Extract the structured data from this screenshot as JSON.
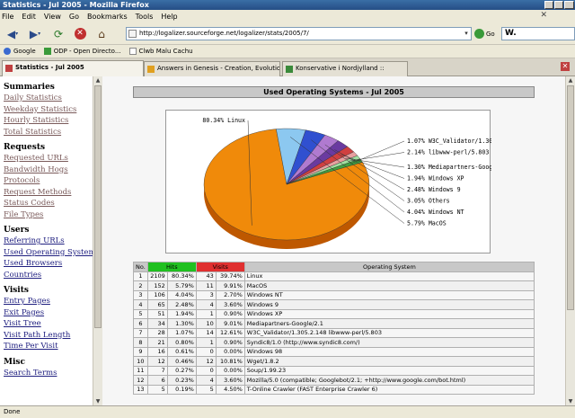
{
  "window": {
    "title": "Statistics - Jul 2005 - Mozilla Firefox"
  },
  "menu": [
    "File",
    "Edit",
    "View",
    "Go",
    "Bookmarks",
    "Tools",
    "Help"
  ],
  "nav": {
    "url": "http://logalizer.sourceforge.net/logalizer/stats/2005/7/",
    "go_label": "Go",
    "search_value": "W."
  },
  "bookmarks": [
    "Google",
    "ODP - Open Directo...",
    "Clwb Malu Cachu"
  ],
  "tabs": [
    {
      "label": "Statistics - Jul 2005",
      "active": true
    },
    {
      "label": "Answers in Genesis - Creation, Evolution, ...",
      "active": false
    },
    {
      "label": "Konservative i Nordjylland ::",
      "active": false
    }
  ],
  "sidebar": {
    "sections": [
      {
        "heading": "Summaries",
        "links": [
          "Daily Statistics",
          "Weekday Statistics",
          "Hourly Statistics",
          "Total Statistics"
        ]
      },
      {
        "heading": "Requests",
        "links": [
          "Requested URLs",
          "Bandwidth Hogs",
          "Protocols",
          "Request Methods",
          "Status Codes",
          "File Types"
        ]
      },
      {
        "heading": "Users",
        "links": [
          "Referring URLs",
          "Used Operating Systems",
          "Used Browsers",
          "Countries"
        ]
      },
      {
        "heading": "Visits",
        "links": [
          "Entry Pages",
          "Exit Pages",
          "Visit Tree",
          "Visit Path Length",
          "Time Per Visit"
        ]
      },
      {
        "heading": "Misc",
        "links": [
          "Search Terms"
        ]
      }
    ]
  },
  "report": {
    "title": "Used Operating Systems - Jul 2005"
  },
  "chart_data": {
    "type": "pie",
    "slices": [
      {
        "label": "Linux",
        "value": 80.34,
        "display": "80.34% Linux",
        "color": "#f08a0a"
      },
      {
        "label": "MacOS",
        "value": 5.79,
        "display": "5.79% MacOS",
        "color": "#8cc8f0"
      },
      {
        "label": "Windows NT",
        "value": 4.04,
        "display": "4.04% Windows NT",
        "color": "#3050d0"
      },
      {
        "label": "Others",
        "value": 3.05,
        "display": "3.05% Others",
        "color": "#b07ad0"
      },
      {
        "label": "Windows 9",
        "value": 2.48,
        "display": "2.48% Windows 9",
        "color": "#6a3aa0"
      },
      {
        "label": "Windows XP",
        "value": 1.94,
        "display": "1.94% Windows XP",
        "color": "#d04040"
      },
      {
        "label": "Mediapartners-Google/2.1",
        "value": 1.3,
        "display": "1.30% Mediapartners-Google/2.1",
        "color": "#e8a0a0"
      },
      {
        "label": "libwww-perl/5.803",
        "value": 1.07,
        "display": "2.14% libwww-perl/5.803",
        "color": "#a0e0a0"
      },
      {
        "label": "W3C_Validator/1.305.2",
        "value": 1.07,
        "display": "1.07% W3C_Validator/1.305.",
        "color": "#40a040"
      }
    ]
  },
  "table": {
    "headers": [
      "No.",
      "Hits",
      "Visits",
      "Operating System"
    ],
    "rows": [
      [
        "1",
        "2109",
        "80.34%",
        "43",
        "39.74%",
        "Linux"
      ],
      [
        "2",
        "152",
        "5.79%",
        "11",
        "9.91%",
        "MacOS"
      ],
      [
        "3",
        "106",
        "4.04%",
        "3",
        "2.70%",
        "Windows NT"
      ],
      [
        "4",
        "65",
        "2.48%",
        "4",
        "3.60%",
        "Windows 9"
      ],
      [
        "5",
        "51",
        "1.94%",
        "1",
        "0.90%",
        "Windows XP"
      ],
      [
        "6",
        "34",
        "1.30%",
        "10",
        "9.01%",
        "Mediapartners-Google/2.1"
      ],
      [
        "7",
        "28",
        "1.07%",
        "14",
        "12.61%",
        "W3C_Validator/1.305.2.148 libwww-perl/5.803"
      ],
      [
        "8",
        "21",
        "0.80%",
        "1",
        "0.90%",
        "Syndic8/1.0 (http://www.syndic8.com/)"
      ],
      [
        "9",
        "16",
        "0.61%",
        "0",
        "0.00%",
        "Windows 98"
      ],
      [
        "10",
        "12",
        "0.46%",
        "12",
        "10.81%",
        "Wget/1.8.2"
      ],
      [
        "11",
        "7",
        "0.27%",
        "0",
        "0.00%",
        "Soup/1.99.23"
      ],
      [
        "12",
        "6",
        "0.23%",
        "4",
        "3.60%",
        "Mozilla/5.0 (compatible; Googlebot/2.1; +http://www.google.com/bot.html)"
      ],
      [
        "13",
        "5",
        "0.19%",
        "5",
        "4.50%",
        "T-Online Crawler (FAST Enterprise Crawler 6)"
      ]
    ]
  },
  "status": {
    "text": "Done"
  }
}
